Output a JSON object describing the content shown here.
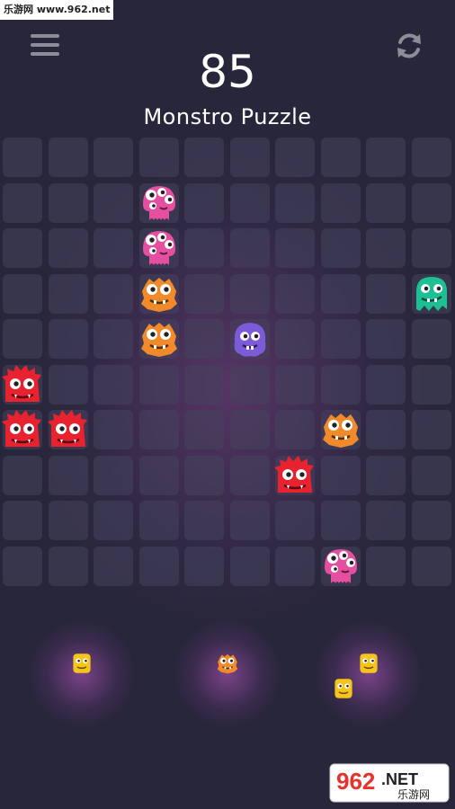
{
  "watermark_top": "乐游网 www.962.net",
  "score": "85",
  "title": "Monstro Puzzle",
  "grid": {
    "rows": 10,
    "cols": 10
  },
  "monsters": [
    {
      "row": 1,
      "col": 3,
      "type": "pink-jelly"
    },
    {
      "row": 2,
      "col": 3,
      "type": "pink-jelly"
    },
    {
      "row": 3,
      "col": 3,
      "type": "orange-fuzzy"
    },
    {
      "row": 3,
      "col": 9,
      "type": "teal-ghost"
    },
    {
      "row": 4,
      "col": 3,
      "type": "orange-fuzzy"
    },
    {
      "row": 4,
      "col": 5,
      "type": "purple-blob"
    },
    {
      "row": 5,
      "col": 0,
      "type": "red-spiky"
    },
    {
      "row": 6,
      "col": 0,
      "type": "red-spiky"
    },
    {
      "row": 6,
      "col": 1,
      "type": "red-spiky"
    },
    {
      "row": 6,
      "col": 7,
      "type": "orange-fuzzy"
    },
    {
      "row": 7,
      "col": 6,
      "type": "red-spiky"
    },
    {
      "row": 9,
      "col": 7,
      "type": "pink-jelly"
    }
  ],
  "trays": [
    {
      "pieces": [
        {
          "type": "yellow-blob",
          "dx": 0,
          "dy": 0
        }
      ]
    },
    {
      "pieces": [
        {
          "type": "orange-fuzzy",
          "dx": 0,
          "dy": 0
        }
      ]
    },
    {
      "pieces": [
        {
          "type": "yellow-blob",
          "dx": 0,
          "dy": 0
        },
        {
          "type": "yellow-blob",
          "dx": -1,
          "dy": 1
        }
      ]
    }
  ],
  "watermark_bottom": {
    "num": "962",
    "net": ".NET",
    "cn": "乐游网"
  },
  "colors": {
    "pink-jelly": "#e54fa0",
    "orange-fuzzy": "#f08a2a",
    "teal-ghost": "#1fbf94",
    "purple-blob": "#7c5bd8",
    "red-spiky": "#e8222e",
    "yellow-blob": "#f6c51b"
  }
}
